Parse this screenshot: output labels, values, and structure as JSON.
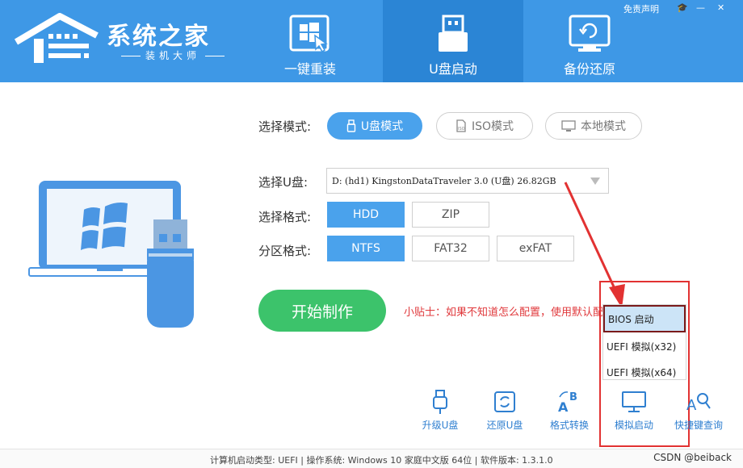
{
  "header": {
    "brand_title": "系统之家",
    "brand_subtitle": "装机大师",
    "tabs": [
      {
        "label": "一键重装",
        "icon": "windows-cursor-icon",
        "active": false
      },
      {
        "label": "U盘启动",
        "icon": "usb-drive-icon",
        "active": true
      },
      {
        "label": "备份还原",
        "icon": "backup-restore-icon",
        "active": false
      }
    ],
    "window_controls": {
      "disclaimer": "免责声明",
      "skin": "🎓",
      "minimize": "—",
      "close": "✕"
    },
    "colors": {
      "bar": "#3e98e6",
      "active_tab": "#2b85d5"
    }
  },
  "mode": {
    "label": "选择模式:",
    "options": [
      {
        "label": "U盘模式",
        "icon": "usb-icon",
        "active": true
      },
      {
        "label": "ISO模式",
        "icon": "iso-file-icon",
        "active": false
      },
      {
        "label": "本地模式",
        "icon": "monitor-icon",
        "active": false
      }
    ]
  },
  "usb_select": {
    "label": "选择U盘:",
    "value": "D: (hd1) KingstonDataTraveler 3.0 (U盘) 26.82GB"
  },
  "format": {
    "label": "选择格式:",
    "options": [
      {
        "label": "HDD",
        "active": true
      },
      {
        "label": "ZIP",
        "active": false
      }
    ]
  },
  "partition": {
    "label": "分区格式:",
    "options": [
      {
        "label": "NTFS",
        "active": true
      },
      {
        "label": "FAT32",
        "active": false
      },
      {
        "label": "exFAT",
        "active": false
      }
    ]
  },
  "start_button": "开始制作",
  "tip": "小贴士：如果不知道怎么配置，使用默认配置即可",
  "boot_dropdown": {
    "items": [
      {
        "label": "BIOS 启动",
        "selected": true
      },
      {
        "label": "UEFI 模拟(x32)",
        "selected": false
      },
      {
        "label": "UEFI 模拟(x64)",
        "selected": false
      }
    ]
  },
  "tools": [
    {
      "label": "升级U盘",
      "icon": "usb-upgrade-icon"
    },
    {
      "label": "还原U盘",
      "icon": "usb-restore-icon"
    },
    {
      "label": "格式转换",
      "icon": "format-convert-icon"
    },
    {
      "label": "模拟启动",
      "icon": "monitor-icon"
    },
    {
      "label": "快捷键查询",
      "icon": "key-search-icon"
    }
  ],
  "status": {
    "text": "计算机启动类型: UEFI | 操作系统: Windows 10 家庭中文版 64位 | 软件版本: 1.3.1.0",
    "watermark": "CSDN @beiback"
  },
  "colors": {
    "accent": "#4aa2ec",
    "start": "#3cc36b",
    "tip": "#e0393c",
    "highlight_box": "#e23232"
  }
}
